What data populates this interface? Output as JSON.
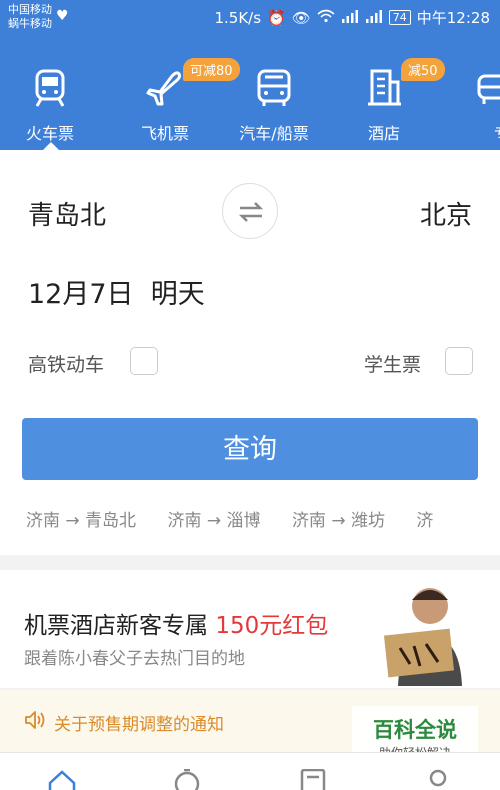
{
  "status_bar": {
    "carrier_line1": "中国移动",
    "carrier_line2": "蜗牛移动",
    "speed": "1.5K/s",
    "battery": "74",
    "time": "中午12:28"
  },
  "nav": {
    "items": [
      {
        "label": "火车票",
        "icon": "train-icon",
        "badge": ""
      },
      {
        "label": "飞机票",
        "icon": "plane-icon",
        "badge": "可减80"
      },
      {
        "label": "汽车/船票",
        "icon": "bus-icon",
        "badge": ""
      },
      {
        "label": "酒店",
        "icon": "hotel-icon",
        "badge": "减50"
      },
      {
        "label": "专车",
        "icon": "car-icon",
        "badge": ""
      }
    ]
  },
  "search": {
    "from_station": "青岛北",
    "to_station": "北京",
    "date": "12月7日",
    "date_relative": "明天",
    "high_speed_label": "高铁动车",
    "student_label": "学生票",
    "query_button": "查询"
  },
  "history": [
    "济南 → 青岛北",
    "济南 → 淄博",
    "济南 → 潍坊",
    "济"
  ],
  "promo": {
    "title": "机票酒店新客专属",
    "highlight": "150元红包",
    "subtitle": "跟着陈小春父子去热门目的地"
  },
  "notice": {
    "text": "关于预售期调整的通知"
  },
  "watermark": {
    "main": "百科全说",
    "sub": "助你轻松解决"
  },
  "colors": {
    "primary": "#3e7fd8",
    "button": "#4f8fe0",
    "badge": "#f4a23b",
    "highlight": "#e5383b",
    "notice_text": "#d98b2b"
  }
}
